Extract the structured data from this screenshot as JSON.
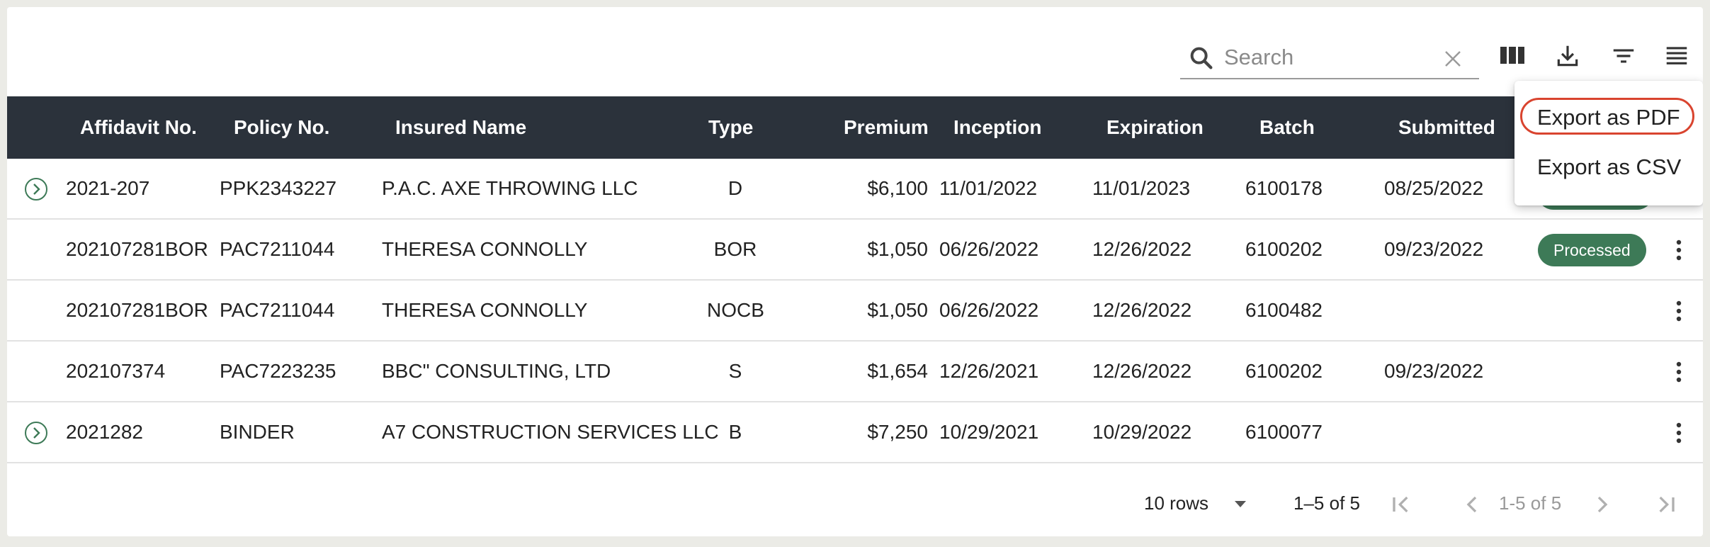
{
  "search": {
    "placeholder": "Search",
    "value": ""
  },
  "toolbar": {
    "icons": [
      "search-icon",
      "clear-icon",
      "columns-icon",
      "download-icon",
      "filter-icon",
      "density-icon"
    ]
  },
  "table": {
    "columns": [
      "Affidavit No.",
      "Policy No.",
      "Insured Name",
      "Type",
      "Premium",
      "Inception",
      "Expiration",
      "Batch",
      "Submitted"
    ],
    "rows": [
      {
        "affidavit": "2021-207",
        "policy": "PPK2343227",
        "insured": "P.A.C. AXE THROWING LLC",
        "type": "D",
        "premium": "$6,100",
        "inception": "11/01/2022",
        "expiration": "11/01/2023",
        "batch": "6100178",
        "submitted": "08/25/2022",
        "status": "",
        "expandable": true
      },
      {
        "affidavit": "202107281BOR",
        "policy": "PAC7211044",
        "insured": "THERESA CONNOLLY",
        "type": "BOR",
        "premium": "$1,050",
        "inception": "06/26/2022",
        "expiration": "12/26/2022",
        "batch": "6100202",
        "submitted": "09/23/2022",
        "status": "Processed",
        "expandable": false
      },
      {
        "affidavit": "202107281BOR",
        "policy": "PAC7211044",
        "insured": "THERESA CONNOLLY",
        "type": "NOCB",
        "premium": "$1,050",
        "inception": "06/26/2022",
        "expiration": "12/26/2022",
        "batch": "6100482",
        "submitted": "",
        "status": "",
        "expandable": false
      },
      {
        "affidavit": "202107374",
        "policy": "PAC7223235",
        "insured": "BBC\" CONSULTING, LTD",
        "type": "S",
        "premium": "$1,654",
        "inception": "12/26/2021",
        "expiration": "12/26/2022",
        "batch": "6100202",
        "submitted": "09/23/2022",
        "status": "",
        "expandable": false
      },
      {
        "affidavit": "2021282",
        "policy": "BINDER",
        "insured": "A7 CONSTRUCTION SERVICES LLC",
        "type": "B",
        "premium": "$7,250",
        "inception": "10/29/2021",
        "expiration": "10/29/2022",
        "batch": "6100077",
        "submitted": "",
        "status": "",
        "expandable": true
      }
    ]
  },
  "footer": {
    "rows_per_page": "10 rows",
    "range": "1–5 of 5",
    "page_info": "1-5 of 5"
  },
  "export_menu": {
    "pdf": "Export as PDF",
    "csv": "Export as CSV"
  },
  "colors": {
    "header_bg": "#2b323b",
    "badge_bg": "#3d7a57",
    "accent": "#3d7a57",
    "highlight_ring": "#d9442f"
  }
}
